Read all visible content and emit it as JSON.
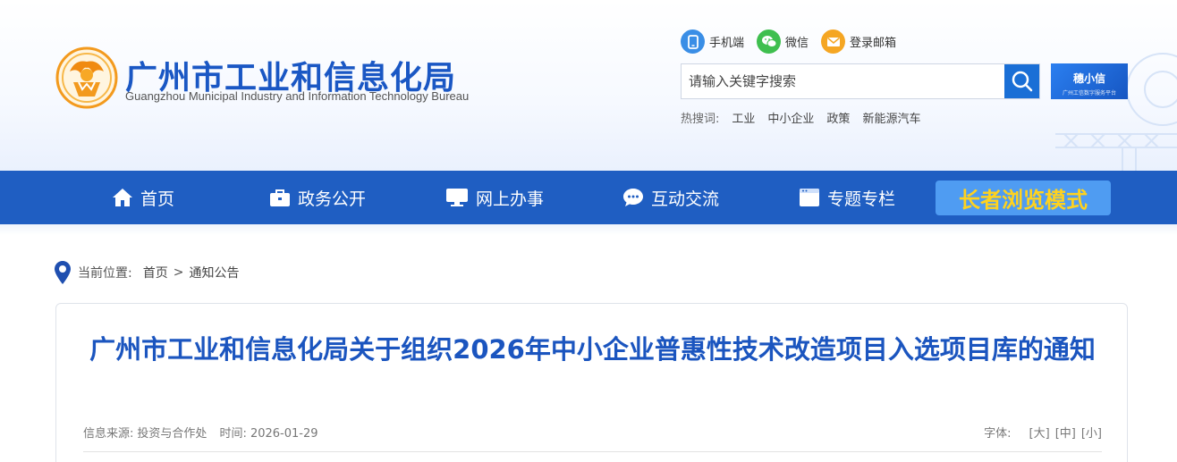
{
  "header": {
    "title": "广州市工业和信息化局",
    "subtitle": "Guangzhou Municipal Industry and Information Technology Bureau",
    "quick_links": [
      {
        "label": "手机端",
        "icon": "mobile-icon",
        "color": "#3a8ee6"
      },
      {
        "label": "微信",
        "icon": "wechat-icon",
        "color": "#3fbf4f"
      },
      {
        "label": "登录邮箱",
        "icon": "mail-icon",
        "color": "#f5a623"
      }
    ],
    "search": {
      "placeholder": "请输入关键字搜索"
    },
    "app_badge": {
      "title": "穗小信",
      "subtitle": "广州工信数字服务平台"
    },
    "hot": {
      "label": "热搜词:",
      "words": [
        "工业",
        "中小企业",
        "政策",
        "新能源汽车"
      ]
    }
  },
  "nav": {
    "items": [
      {
        "label": "首页",
        "icon": "home-icon"
      },
      {
        "label": "政务公开",
        "icon": "briefcase-icon"
      },
      {
        "label": "网上办事",
        "icon": "monitor-icon"
      },
      {
        "label": "互动交流",
        "icon": "chat-icon"
      },
      {
        "label": "专题专栏",
        "icon": "window-icon"
      }
    ],
    "elder_mode": "长者浏览模式",
    "bg_color": "#1f5ec2"
  },
  "breadcrumb": {
    "label": "当前位置:",
    "items": [
      "首页",
      "通知公告"
    ],
    "separator": ">"
  },
  "article": {
    "title": "广州市工业和信息化局关于组织2026年中小企业普惠性技术改造项目入选项目库的通知",
    "source_label": "信息来源:",
    "source": "投资与合作处",
    "time_label": "时间:",
    "time": "2026-01-29",
    "font_label": "字体:",
    "font_sizes": [
      "[大]",
      "[中]",
      "[小]"
    ]
  }
}
